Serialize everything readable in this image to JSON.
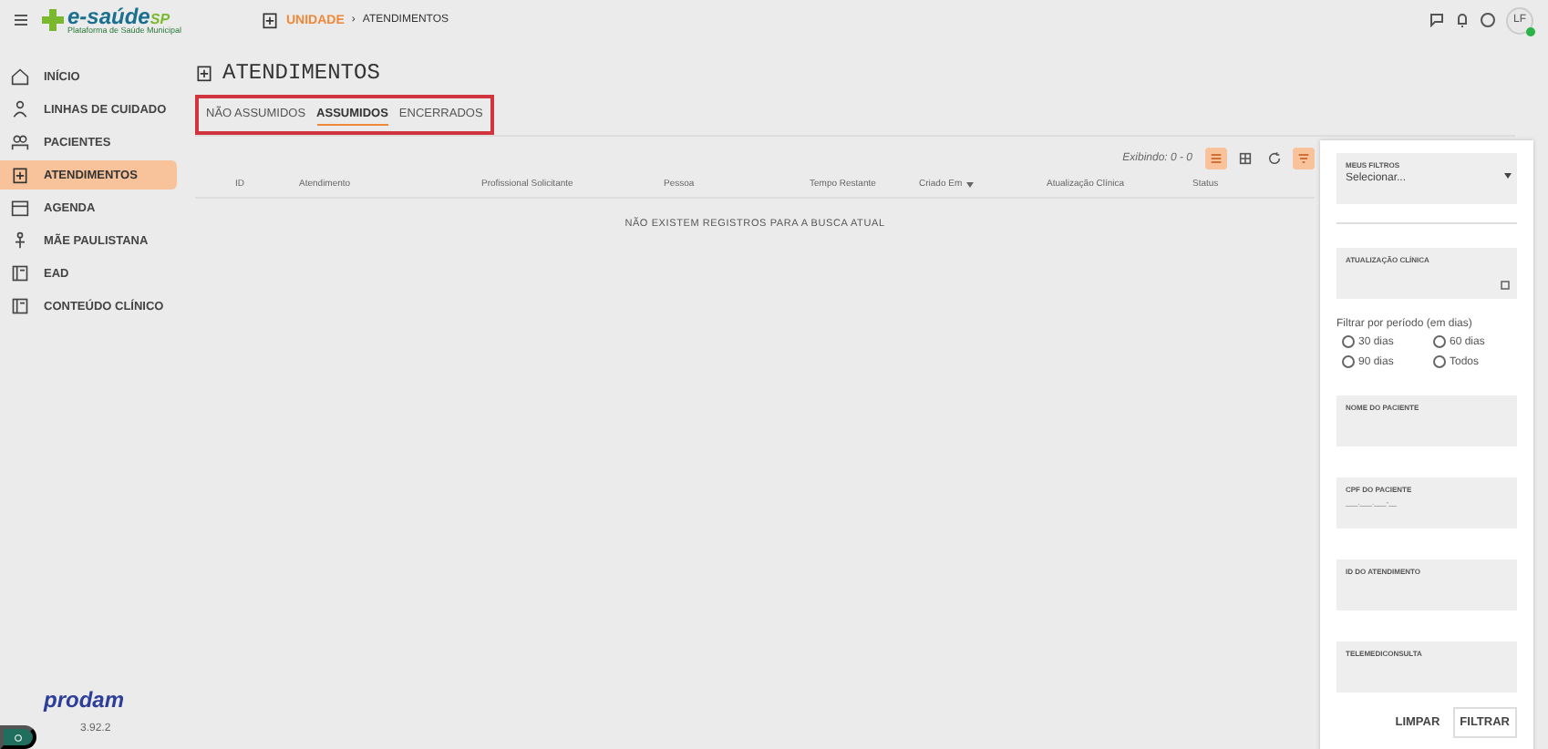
{
  "header": {
    "logo": "e-saúde",
    "logo_suffix": "SP",
    "logo_tagline": "Plataforma de Saúde Municipal",
    "breadcrumb": [
      {
        "label": "UNIDADE",
        "kind": "link"
      },
      {
        "label": "›",
        "kind": "separator"
      },
      {
        "label": "ATENDIMENTOS",
        "kind": "current"
      }
    ],
    "avatar": "LF"
  },
  "sidebar": {
    "items": [
      {
        "label": "INÍCIO",
        "selected": false
      },
      {
        "label": "LINHAS DE CUIDADO",
        "selected": false
      },
      {
        "label": "PACIENTES",
        "selected": false
      },
      {
        "label": "ATENDIMENTOS",
        "selected": true
      },
      {
        "label": "AGENDA",
        "selected": false
      },
      {
        "label": "MÃE PAULISTANA",
        "selected": false
      },
      {
        "label": "EAD",
        "selected": false
      },
      {
        "label": "CONTEÚDO CLÍNICO",
        "selected": false
      }
    ],
    "brand": "prodam",
    "version": "3.92.2"
  },
  "page": {
    "title": "ATENDIMENTOS",
    "tabs": [
      {
        "label": "NÃO ASSUMIDOS",
        "selected": false
      },
      {
        "label": "ASSUMIDOS",
        "selected": true
      },
      {
        "label": "ENCERRADOS",
        "selected": false
      }
    ],
    "showing": "Exibindo: 0 - 0",
    "toolbar": [
      {
        "on": true
      },
      {
        "on": false
      },
      {
        "on": false
      },
      {
        "on": true
      }
    ],
    "table": {
      "columns": [
        {
          "label": "ID",
          "sort": false
        },
        {
          "label": "Atendimento",
          "sort": false
        },
        {
          "label": "Profissional Solicitante",
          "sort": false
        },
        {
          "label": "Pessoa",
          "sort": false
        },
        {
          "label": "Tempo Restante",
          "sort": false
        },
        {
          "label": "Criado Em",
          "sort": true
        },
        {
          "label": "Atualização Clínica",
          "sort": false
        },
        {
          "label": "Status",
          "sort": false
        }
      ],
      "empty": "NÃO EXISTEM REGISTROS PARA A BUSCA ATUAL"
    }
  },
  "filters": {
    "saved": {
      "label": "MEUS FILTROS",
      "value": "Selecionar..."
    },
    "update_field": {
      "label": "ATUALIZAÇÃO CLÍNICA"
    },
    "period": {
      "label": "Filtrar por período (em dias)",
      "options": [
        {
          "label": "30 dias",
          "selected": false
        },
        {
          "label": "60 dias",
          "selected": false
        },
        {
          "label": "90 dias",
          "selected": false
        },
        {
          "label": "Todos",
          "selected": false
        }
      ]
    },
    "fields": [
      {
        "label": "NOME DO PACIENTE"
      },
      {
        "label": "CPF DO PACIENTE",
        "placeholder": "___.___.___-__"
      },
      {
        "label": "ID DO ATENDIMENTO"
      },
      {
        "label": "TELEMEDICONSULTA"
      }
    ],
    "buttons": [
      {
        "label": "LIMPAR",
        "kind": "text"
      },
      {
        "label": "FILTRAR",
        "kind": "outlined"
      }
    ]
  }
}
